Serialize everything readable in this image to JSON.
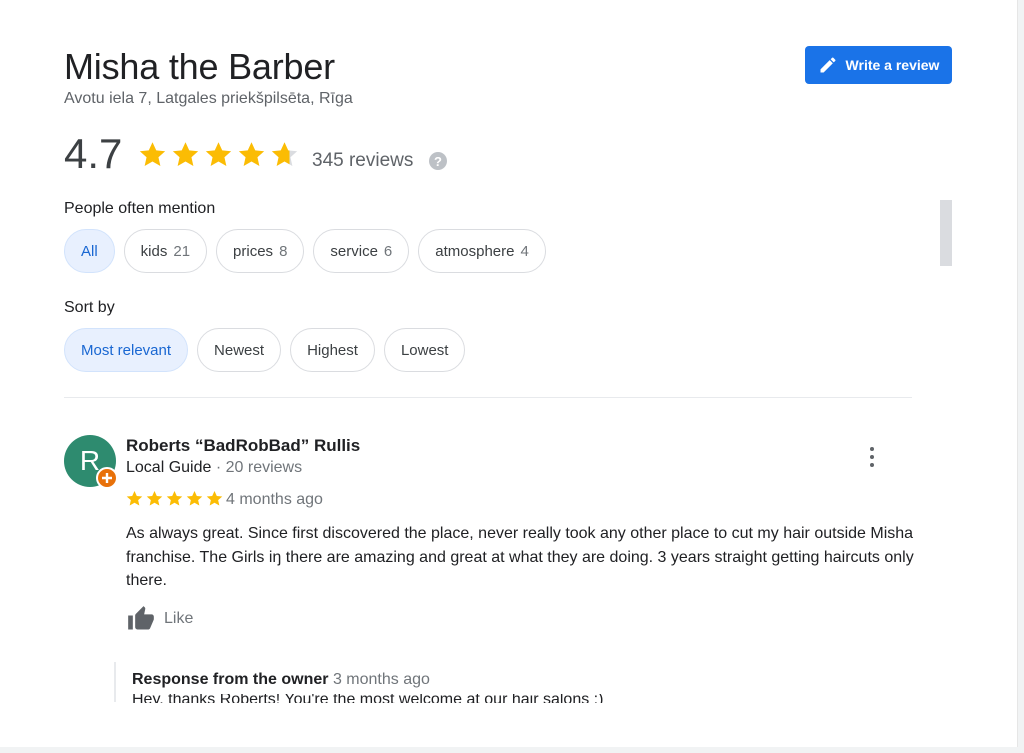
{
  "place": {
    "name": "Misha the Barber",
    "address": "Avotu iela 7, Latgales priekšpilsēta, Rīga",
    "rating": "4.7",
    "rating_value": 4.7,
    "reviews_count": "345 reviews",
    "write_review_label": "Write a review"
  },
  "mentions": {
    "label": "People often mention",
    "chips": [
      {
        "label": "All",
        "count": ""
      },
      {
        "label": "kids",
        "count": "21"
      },
      {
        "label": "prices",
        "count": "8"
      },
      {
        "label": "service",
        "count": "6"
      },
      {
        "label": "atmosphere",
        "count": "4"
      }
    ]
  },
  "sort": {
    "label": "Sort by",
    "options": [
      "Most relevant",
      "Newest",
      "Highest",
      "Lowest"
    ],
    "selected": "Most relevant"
  },
  "review": {
    "avatar_letter": "R",
    "author": "Roberts “BadRobBad” Rullis",
    "badge": "Local Guide",
    "author_reviews": "· 20 reviews",
    "stars": 5,
    "date": "4 months ago",
    "text": "As always great. Since first discovered the place, never really took any other place to cut my hair outside Misha franchise. The Girls iŋ there are amazing and great at what they are doing. 3 years straight getting haircuts only there.",
    "like_label": "Like",
    "response": {
      "label": "Response from the owner",
      "date": "3 months ago",
      "text": "Hey, thanks Roberts! You're the most welcome at our hair salons ;)"
    }
  },
  "colors": {
    "accent": "#1a73e8",
    "star": "#fbbc04",
    "avatar": "#2e8b6f",
    "guide_badge": "#e8710a"
  }
}
